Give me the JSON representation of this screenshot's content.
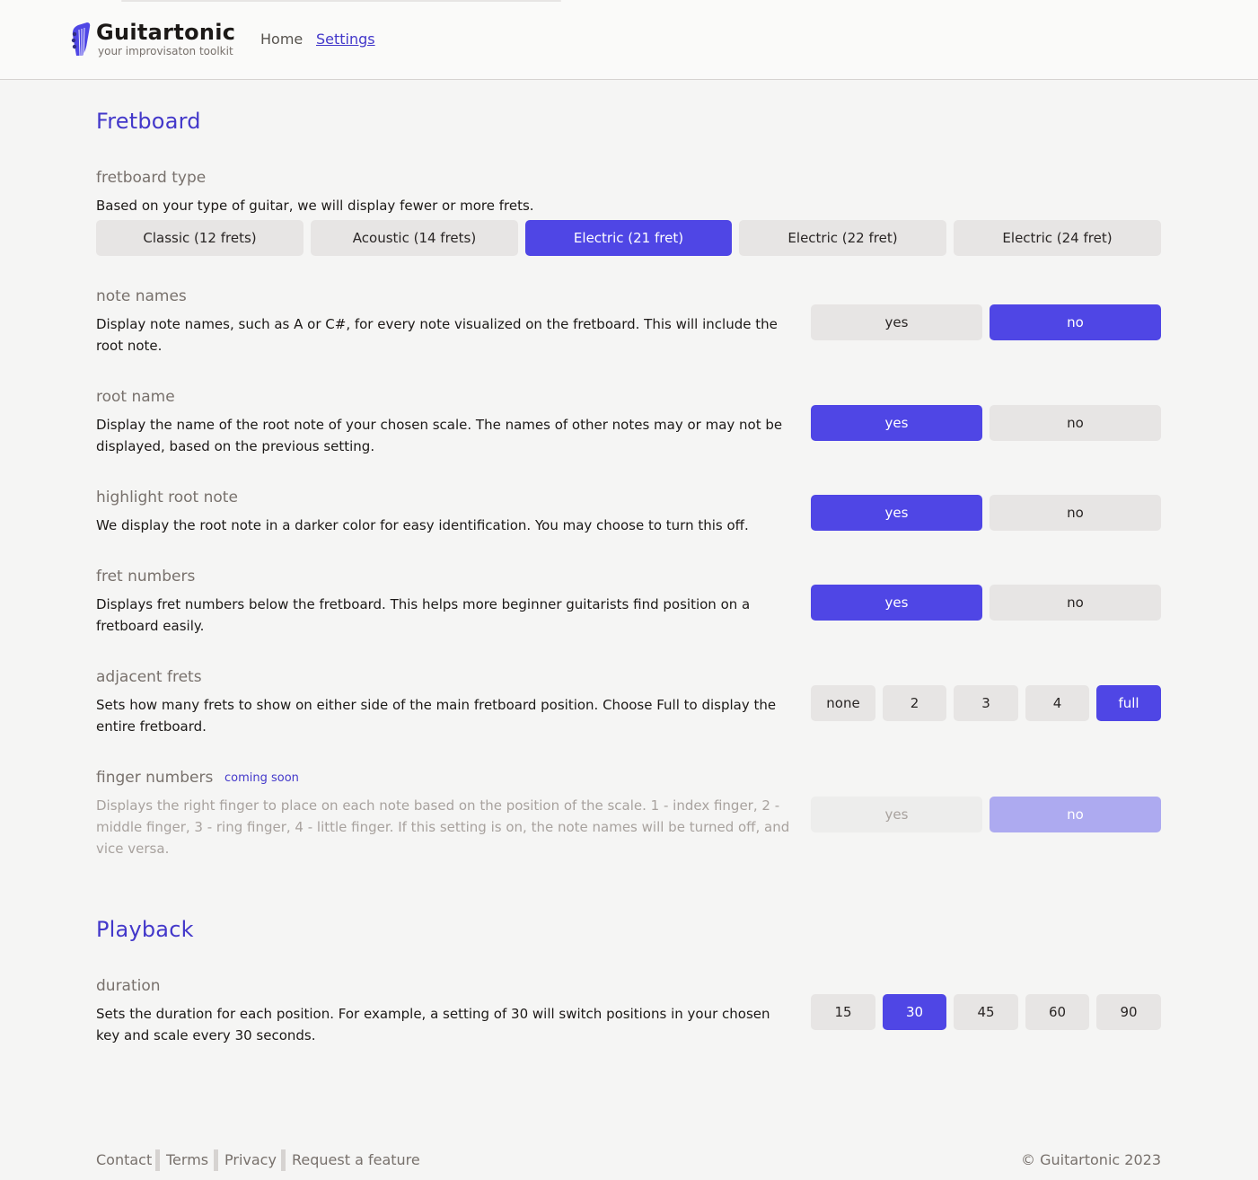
{
  "header": {
    "brand": "Guitartonic",
    "tagline": "your improvisaton toolkit",
    "nav": {
      "home": "Home",
      "settings": "Settings"
    }
  },
  "sections": {
    "fretboard": "Fretboard",
    "playback": "Playback"
  },
  "settings": {
    "fretboard_type": {
      "title": "fretboard type",
      "desc": "Based on your type of guitar, we will display fewer or more frets.",
      "options": [
        "Classic (12 frets)",
        "Acoustic (14 frets)",
        "Electric (21 fret)",
        "Electric (22 fret)",
        "Electric (24 fret)"
      ],
      "selected": "Electric (21 fret)"
    },
    "note_names": {
      "title": "note names",
      "desc": "Display note names, such as A or C#, for every note visualized on the fretboard. This will include the root note.",
      "options": [
        "yes",
        "no"
      ],
      "selected": "no"
    },
    "root_name": {
      "title": "root name",
      "desc": "Display the name of the root note of your chosen scale. The names of other notes may or may not be displayed, based on the previous setting.",
      "options": [
        "yes",
        "no"
      ],
      "selected": "yes"
    },
    "highlight_root": {
      "title": "highlight root note",
      "desc": "We display the root note in a darker color for easy identification. You may choose to turn this off.",
      "options": [
        "yes",
        "no"
      ],
      "selected": "yes"
    },
    "fret_numbers": {
      "title": "fret numbers",
      "desc": "Displays fret numbers below the fretboard. This helps more beginner guitarists find position on a fretboard easily.",
      "options": [
        "yes",
        "no"
      ],
      "selected": "yes"
    },
    "adjacent_frets": {
      "title": "adjacent frets",
      "desc": "Sets how many frets to show on either side of the main fretboard position. Choose Full to display the entire fretboard.",
      "options": [
        "none",
        "2",
        "3",
        "4",
        "full"
      ],
      "selected": "full"
    },
    "finger_numbers": {
      "title": "finger numbers",
      "badge": "coming soon",
      "desc": "Displays the right finger to place on each note based on the position of the scale. 1 - index finger, 2 - middle finger, 3 - ring finger, 4 - little finger. If this setting is on, the note names will be turned off, and vice versa.",
      "options": [
        "yes",
        "no"
      ],
      "selected": "no",
      "disabled": true
    },
    "duration": {
      "title": "duration",
      "desc": "Sets the duration for each position. For example, a setting of 30 will switch positions in your chosen key and scale every 30 seconds.",
      "options": [
        "15",
        "30",
        "45",
        "60",
        "90"
      ],
      "selected": "30"
    }
  },
  "footer": {
    "links": [
      "Contact",
      "Terms",
      "Privacy",
      "Request a feature"
    ],
    "copyright": "© Guitartonic 2023"
  },
  "colors": {
    "accent": "#4f46e5",
    "accent_text": "#4338ca",
    "option_bg": "#e7e5e4",
    "page_bg": "#f5f5f4"
  },
  "icons": {
    "logo": "guitar-headstock-icon"
  }
}
